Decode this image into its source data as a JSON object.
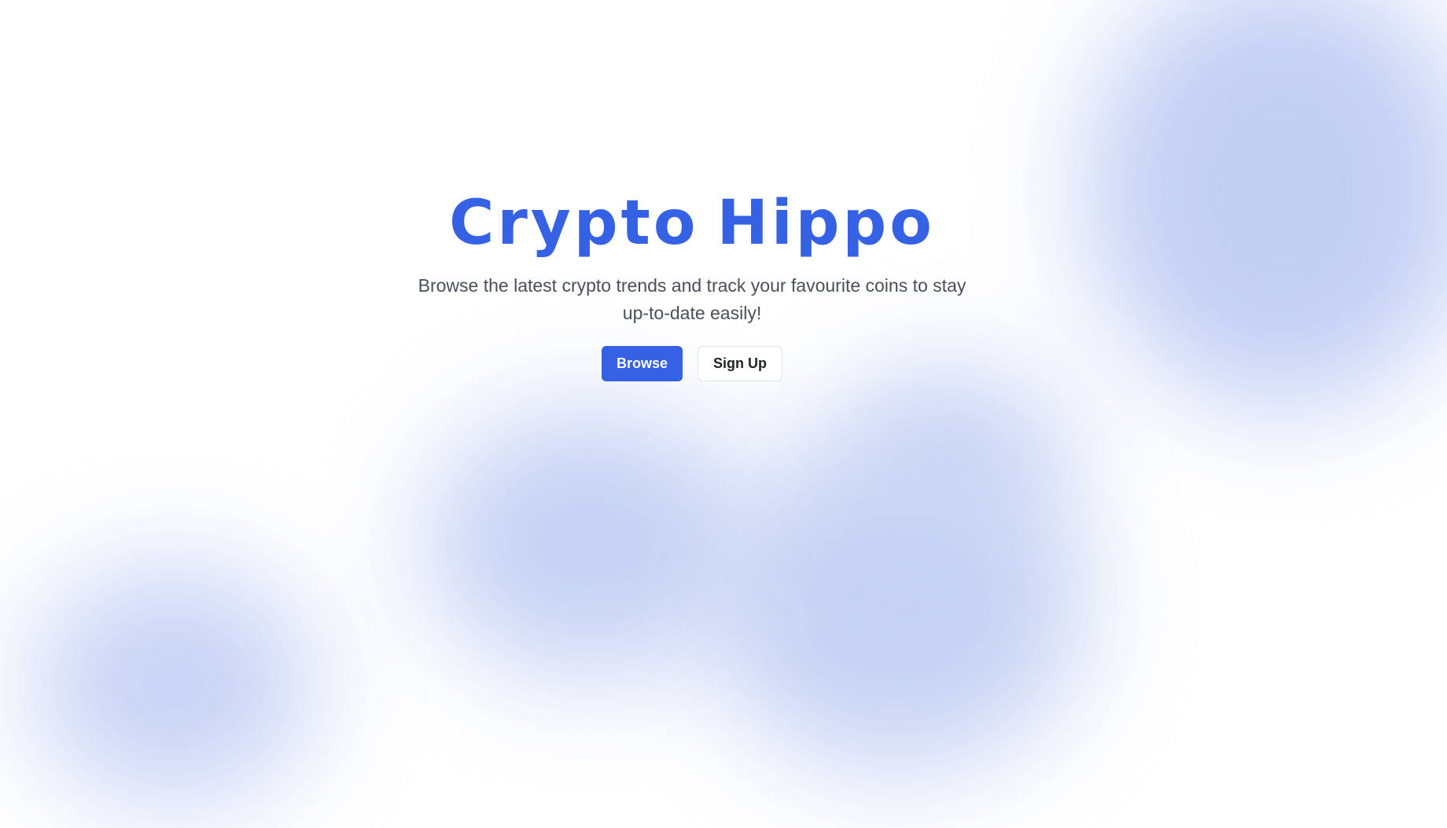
{
  "hero": {
    "title": "Crypto Hippo",
    "subtitle": "Browse the latest crypto trends and track your favourite coins to stay up-to-date easily!"
  },
  "actions": {
    "browse_label": "Browse",
    "signup_label": "Sign Up"
  },
  "colors": {
    "accent": "#3561e4",
    "blob": "#c3cff3",
    "background": "#ffffff"
  }
}
